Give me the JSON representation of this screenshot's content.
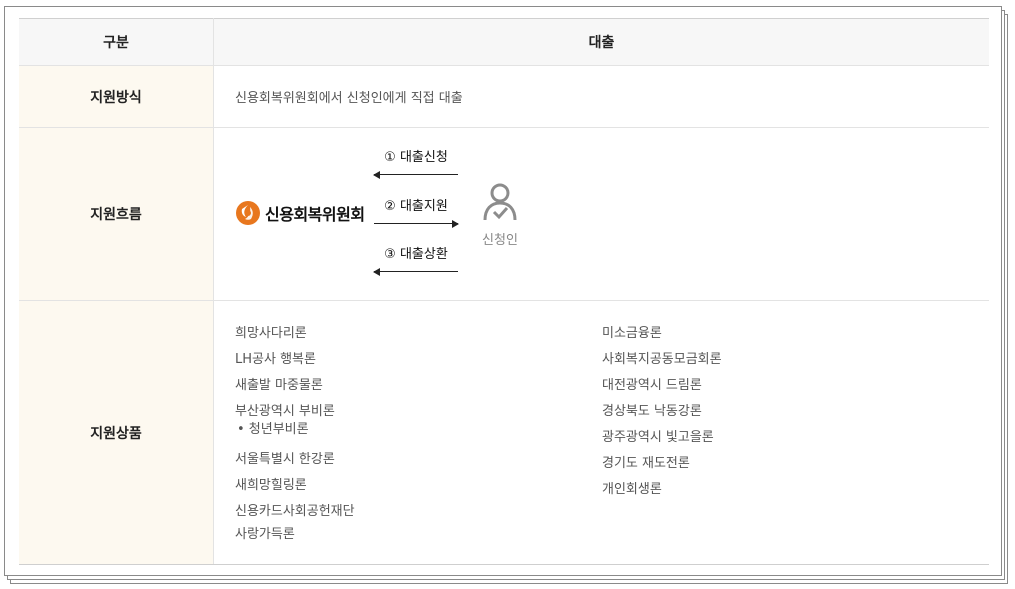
{
  "table": {
    "header": {
      "col1": "구분",
      "col2": "대출"
    },
    "support_method": {
      "label": "지원방식",
      "value": "신용회복위원회에서 신청인에게 직접 대출"
    },
    "support_flow": {
      "label": "지원흐름",
      "org_name": "신용회복위원회",
      "steps": [
        "① 대출신청",
        "② 대출지원",
        "③ 대출상환"
      ],
      "applicant": "신청인",
      "icon": "person-check-icon"
    },
    "products": {
      "label": "지원상품",
      "left": [
        "희망사다리론",
        "LH공사 행복론",
        "새출발 마중물론",
        "부산광역시 부비론",
        "• 청년부비론",
        "서울특별시 한강론",
        "새희망힐링론",
        "신용카드사회공헌재단",
        "사랑가득론"
      ],
      "right": [
        "미소금융론",
        "사회복지공동모금회론",
        "대전광역시 드림론",
        "경상북도 낙동강론",
        "광주광역시 빛고을론",
        "경기도 재도전론",
        "개인회생론"
      ]
    }
  },
  "colors": {
    "label_bg": "#fdf9f0",
    "header_bg": "#f7f7f7",
    "logo_orange": "#e8771e"
  }
}
